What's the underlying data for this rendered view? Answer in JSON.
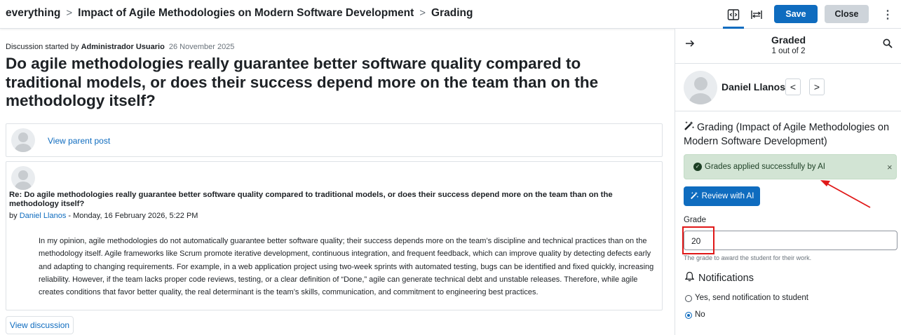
{
  "header": {
    "breadcrumb": [
      "everything",
      "Impact of Agile Methodologies on Modern Software Development",
      "Grading"
    ],
    "separator": ">",
    "save_label": "Save",
    "close_label": "Close",
    "more_label": "⋮"
  },
  "discussion": {
    "started_prefix": "Discussion started by",
    "author": "Administrador Usuario",
    "date": "26 November 2025",
    "title": "Do agile methodologies really guarantee better software quality compared to traditional models, or does their success depend more on the team than on the methodology itself?",
    "view_parent_label": "View parent post",
    "reply": {
      "subject": "Re: Do agile methodologies really guarantee better software quality compared to traditional models, or does their success depend more on the team than on the methodology itself?",
      "by_prefix": "by",
      "author": "Daniel Llanos",
      "datetime": "- Monday, 16 February 2026, 5:22 PM",
      "body": "In my opinion, agile methodologies do not automatically guarantee better software quality; their success depends more on the team’s discipline and technical practices than on the methodology itself. Agile frameworks like Scrum promote iterative development, continuous integration, and frequent feedback, which can improve quality by detecting defects early and adapting to changing requirements. For example, in a web application project using two-week sprints with automated testing, bugs can be identified and fixed quickly, increasing reliability. However, if the team lacks proper code reviews, testing, or a clear definition of “Done,” agile can generate technical debt and unstable releases. Therefore, while agile creates conditions that favor better quality, the real determinant is the team’s skills, communication, and commitment to engineering best practices."
    },
    "view_discussion_label": "View discussion"
  },
  "panel": {
    "title": "Graded",
    "subtitle": "1 out of 2",
    "user_name": "Daniel Llanos",
    "prev_label": "<",
    "next_label": ">",
    "grading_heading": "Grading (Impact of Agile Methodologies on Modern Software Development)",
    "alert_text": "Grades applied successfully by AI",
    "alert_close": "×",
    "review_label": "Review with AI",
    "grade_label": "Grade",
    "grade_value": "20",
    "grade_help": "The grade to award the student for their work.",
    "notifications_heading": "Notifications",
    "notify_options": [
      {
        "label": "Yes, send notification to student",
        "checked": false
      },
      {
        "label": "No",
        "checked": true
      }
    ]
  },
  "colors": {
    "primary": "#0f6cbf",
    "alert_bg": "#d2e4d4",
    "annotation": "#e01818"
  }
}
